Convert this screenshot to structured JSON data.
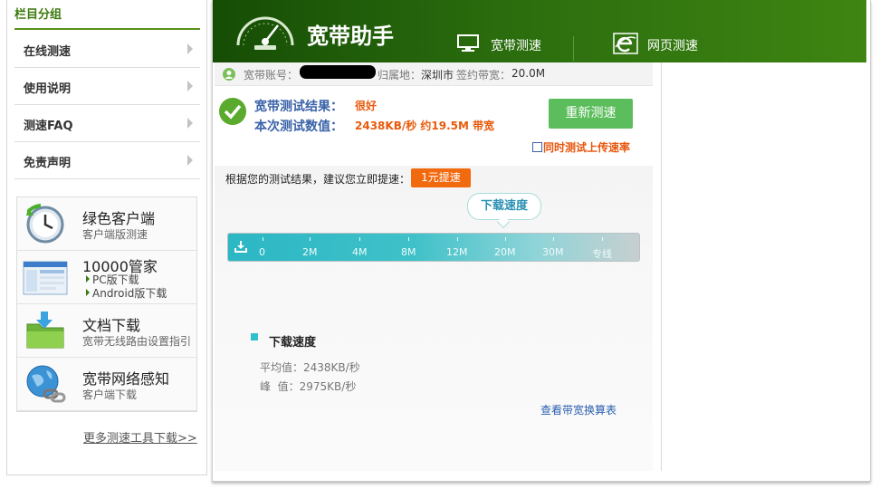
{
  "sidebar": {
    "title": "栏目分组",
    "items": [
      {
        "label": "在线测速"
      },
      {
        "label": "使用说明"
      },
      {
        "label": "测速FAQ"
      },
      {
        "label": "免责声明"
      }
    ],
    "tools": [
      {
        "title": "绿色客户端",
        "subtitle": "客户端版测速",
        "icon": "clock-icon"
      },
      {
        "title": "10000管家",
        "link1": "PC版下载",
        "link2": "Android版下载",
        "icon": "software-window-icon"
      },
      {
        "title": "文档下载",
        "subtitle": "宽带无线路由设置指引",
        "icon": "folder-download-icon"
      },
      {
        "title": "宽带网络感知",
        "subtitle": "客户端下载",
        "icon": "globe-link-icon"
      }
    ],
    "more_link": "更多测速工具下载>>"
  },
  "header": {
    "title": "宽带助手",
    "tabs": [
      {
        "label": "宽带测速",
        "icon": "monitor-icon"
      },
      {
        "label": "网页测速",
        "icon": "ie-icon"
      }
    ]
  },
  "info_bar": {
    "account_label": "宽带账号：",
    "location_label": "归属地：",
    "location_value": "深圳市",
    "bandwidth_label": "签约带宽：",
    "bandwidth_value": "20.0M"
  },
  "result": {
    "label1": "宽带测试结果：",
    "value1": "很好",
    "label2": "本次测试数值：",
    "value2": "2438KB/秒 约19.5M 带宽",
    "retest_button": "重新测速",
    "upload_checkbox_label": "同时测试上传速率"
  },
  "test": {
    "advice": "根据您的测试结果，建议您立即提速：",
    "speedup_button": "1元提速",
    "bubble": "下载速度",
    "gauge_ticks": [
      "0",
      "2M",
      "4M",
      "8M",
      "12M",
      "20M",
      "30M",
      "专线"
    ],
    "legend": "下载速度",
    "avg_label": "平均值：",
    "avg_value": "2438KB/秒",
    "peak_label": "峰  值：",
    "peak_value": "2975KB/秒",
    "conversion_link": "查看带宽换算表"
  },
  "colors": {
    "header_green": "#2b6d0e",
    "accent_orange": "#e85a0c",
    "button_green": "#5cbd5c",
    "gauge_teal": "#2bb7c4"
  }
}
